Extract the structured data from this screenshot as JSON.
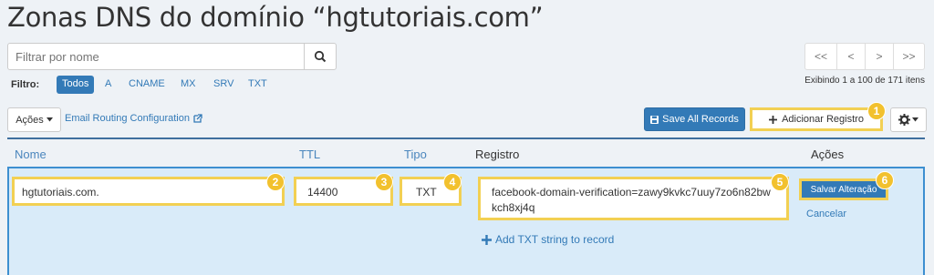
{
  "page": {
    "title": "Zonas DNS do domínio “hgtutoriais.com”"
  },
  "search": {
    "placeholder": "Filtrar por nome"
  },
  "filter": {
    "label": "Filtro:",
    "items": [
      "Todos",
      "A",
      "CNAME",
      "MX",
      "SRV",
      "TXT"
    ],
    "active": "Todos"
  },
  "pagination": {
    "first": "<<",
    "prev": "<",
    "next": ">",
    "last": ">>",
    "summary": "Exibindo 1 a 100 de 171 itens"
  },
  "toolbar": {
    "actions_label": "Ações",
    "email_routing": "Email Routing Configuration",
    "save_all": "Save All Records",
    "add_record": "Adicionar Registro"
  },
  "table": {
    "headers": {
      "name": "Nome",
      "ttl": "TTL",
      "type": "Tipo",
      "record": "Registro",
      "actions": "Ações"
    }
  },
  "edit_row": {
    "name": "hgtutoriais.com.",
    "ttl": "14400",
    "type": "TXT",
    "record": "facebook-domain-verification=zawy9kvkc7uuy7zo6n82bwkch8xj4q",
    "save": "Salvar Alteração",
    "cancel": "Cancelar",
    "add_txt": "Add TXT string to record"
  },
  "badges": [
    "1",
    "2",
    "3",
    "4",
    "5",
    "6"
  ],
  "colors": {
    "accent": "#337ab7",
    "highlight": "#f2d053",
    "badge": "#f2c12e",
    "row_bg": "#d9ebf9"
  }
}
